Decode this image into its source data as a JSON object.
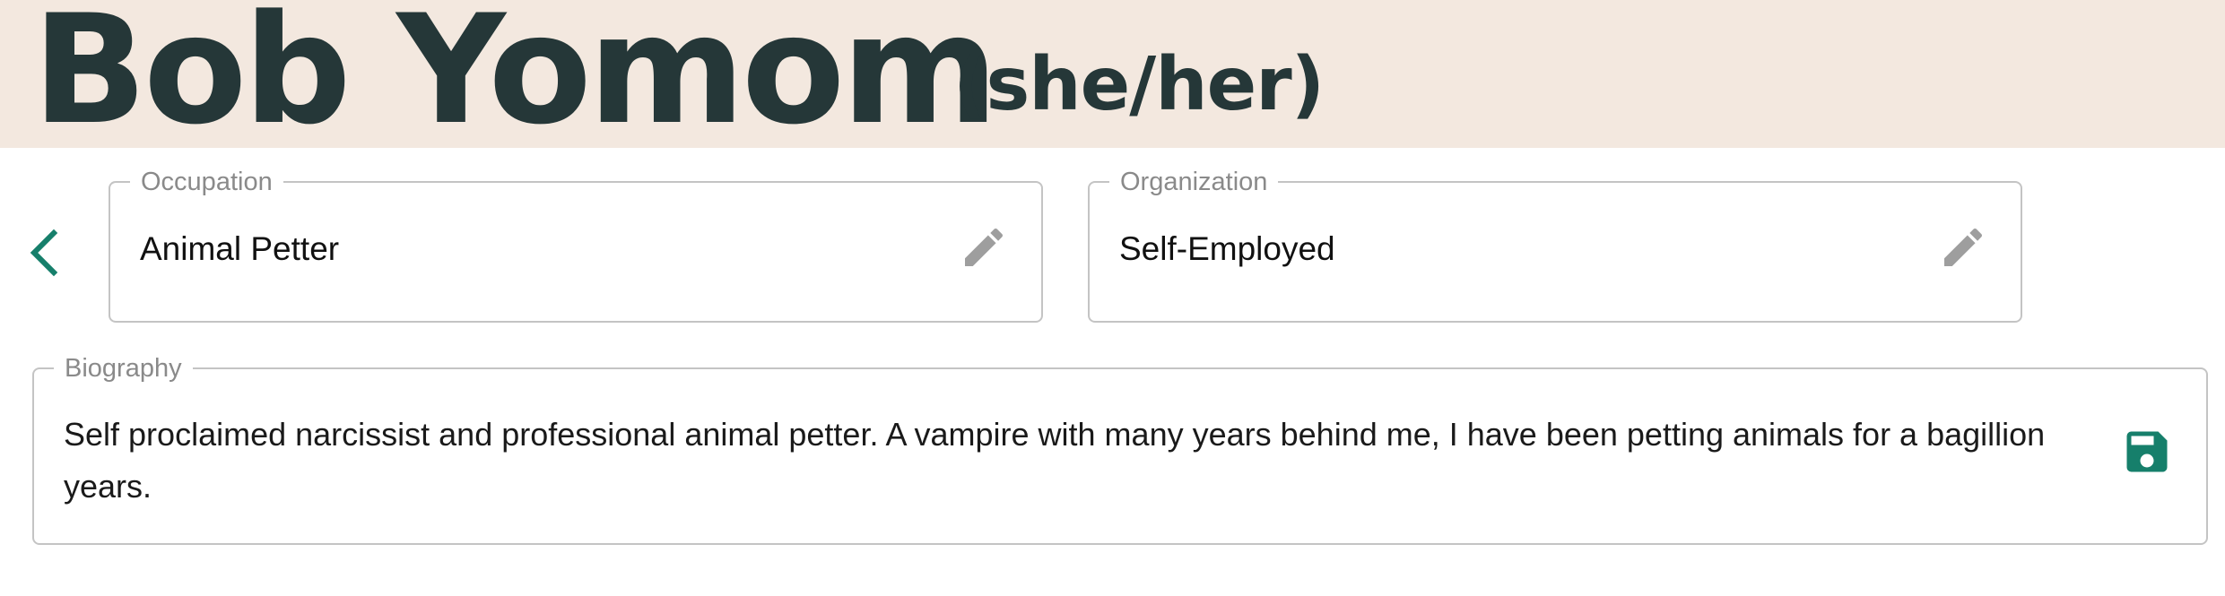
{
  "profile": {
    "name": "Bob Yomom",
    "pronouns": "(she/her)"
  },
  "fields": {
    "occupation": {
      "label": "Occupation",
      "value": "Animal Petter"
    },
    "organization": {
      "label": "Organization",
      "value": "Self-Employed"
    },
    "biography": {
      "label": "Biography",
      "value": "Self proclaimed narcissist and professional animal petter. A vampire with many years behind me, I have been petting animals for a bagillion years."
    }
  },
  "icons": {
    "back": "chevron-left-icon",
    "edit": "pencil-icon",
    "save": "floppy-disk-icon"
  },
  "colors": {
    "header_background": "#f3e8df",
    "name_text": "#253738",
    "accent": "#167f6b",
    "edit_icon": "#9e9e9e",
    "field_border": "#c4c4c4"
  }
}
